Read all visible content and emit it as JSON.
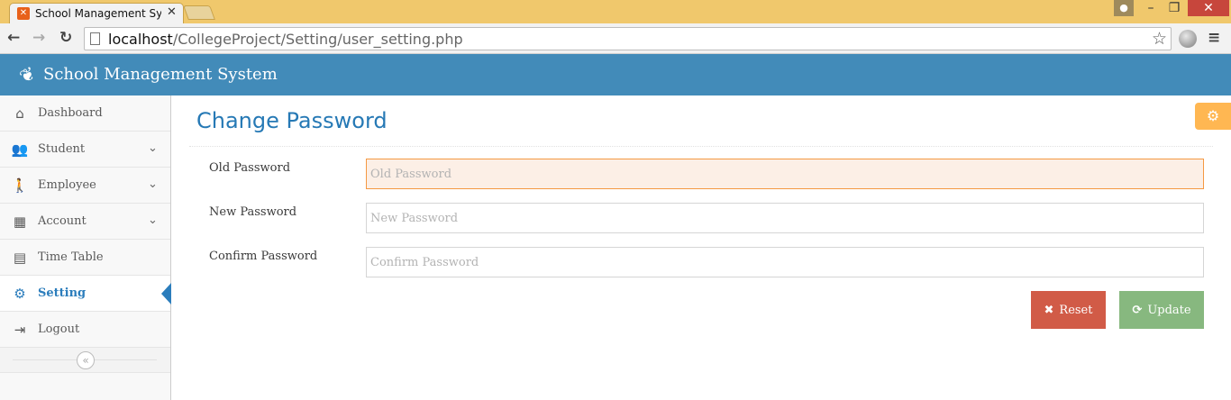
{
  "browser": {
    "tab_title": "School Management System",
    "tab_close": "✕",
    "url_host": "localhost",
    "url_path": "/CollegeProject/Setting/user_setting.php"
  },
  "app": {
    "title": "School Management System"
  },
  "sidebar": {
    "items": [
      {
        "label": "Dashboard",
        "icon": "home-icon",
        "glyph": "⌂"
      },
      {
        "label": "Student",
        "icon": "users-icon",
        "glyph": "👥",
        "chevron": "⌄"
      },
      {
        "label": "Employee",
        "icon": "person-icon",
        "glyph": "🚶",
        "chevron": "⌄"
      },
      {
        "label": "Account",
        "icon": "calculator-icon",
        "glyph": "▦",
        "chevron": "⌄"
      },
      {
        "label": "Time Table",
        "icon": "calendar-icon",
        "glyph": "▤"
      },
      {
        "label": "Setting",
        "icon": "gear-icon",
        "glyph": "⚙",
        "active": true
      },
      {
        "label": "Logout",
        "icon": "logout-icon",
        "glyph": "⇥"
      }
    ],
    "collapse_glyph": "«"
  },
  "page": {
    "title": "Change Password"
  },
  "form": {
    "old_label": "Old Password",
    "old_placeholder": "Old Password",
    "new_label": "New Password",
    "new_placeholder": "New Password",
    "confirm_label": "Confirm Password",
    "confirm_placeholder": "Confirm Password",
    "reset_label": "Reset",
    "update_label": "Update"
  },
  "colors": {
    "header": "#428bb9",
    "accent": "#2679b5",
    "reset": "#d15b47",
    "update": "#87b87f",
    "settings": "#ffb752"
  }
}
